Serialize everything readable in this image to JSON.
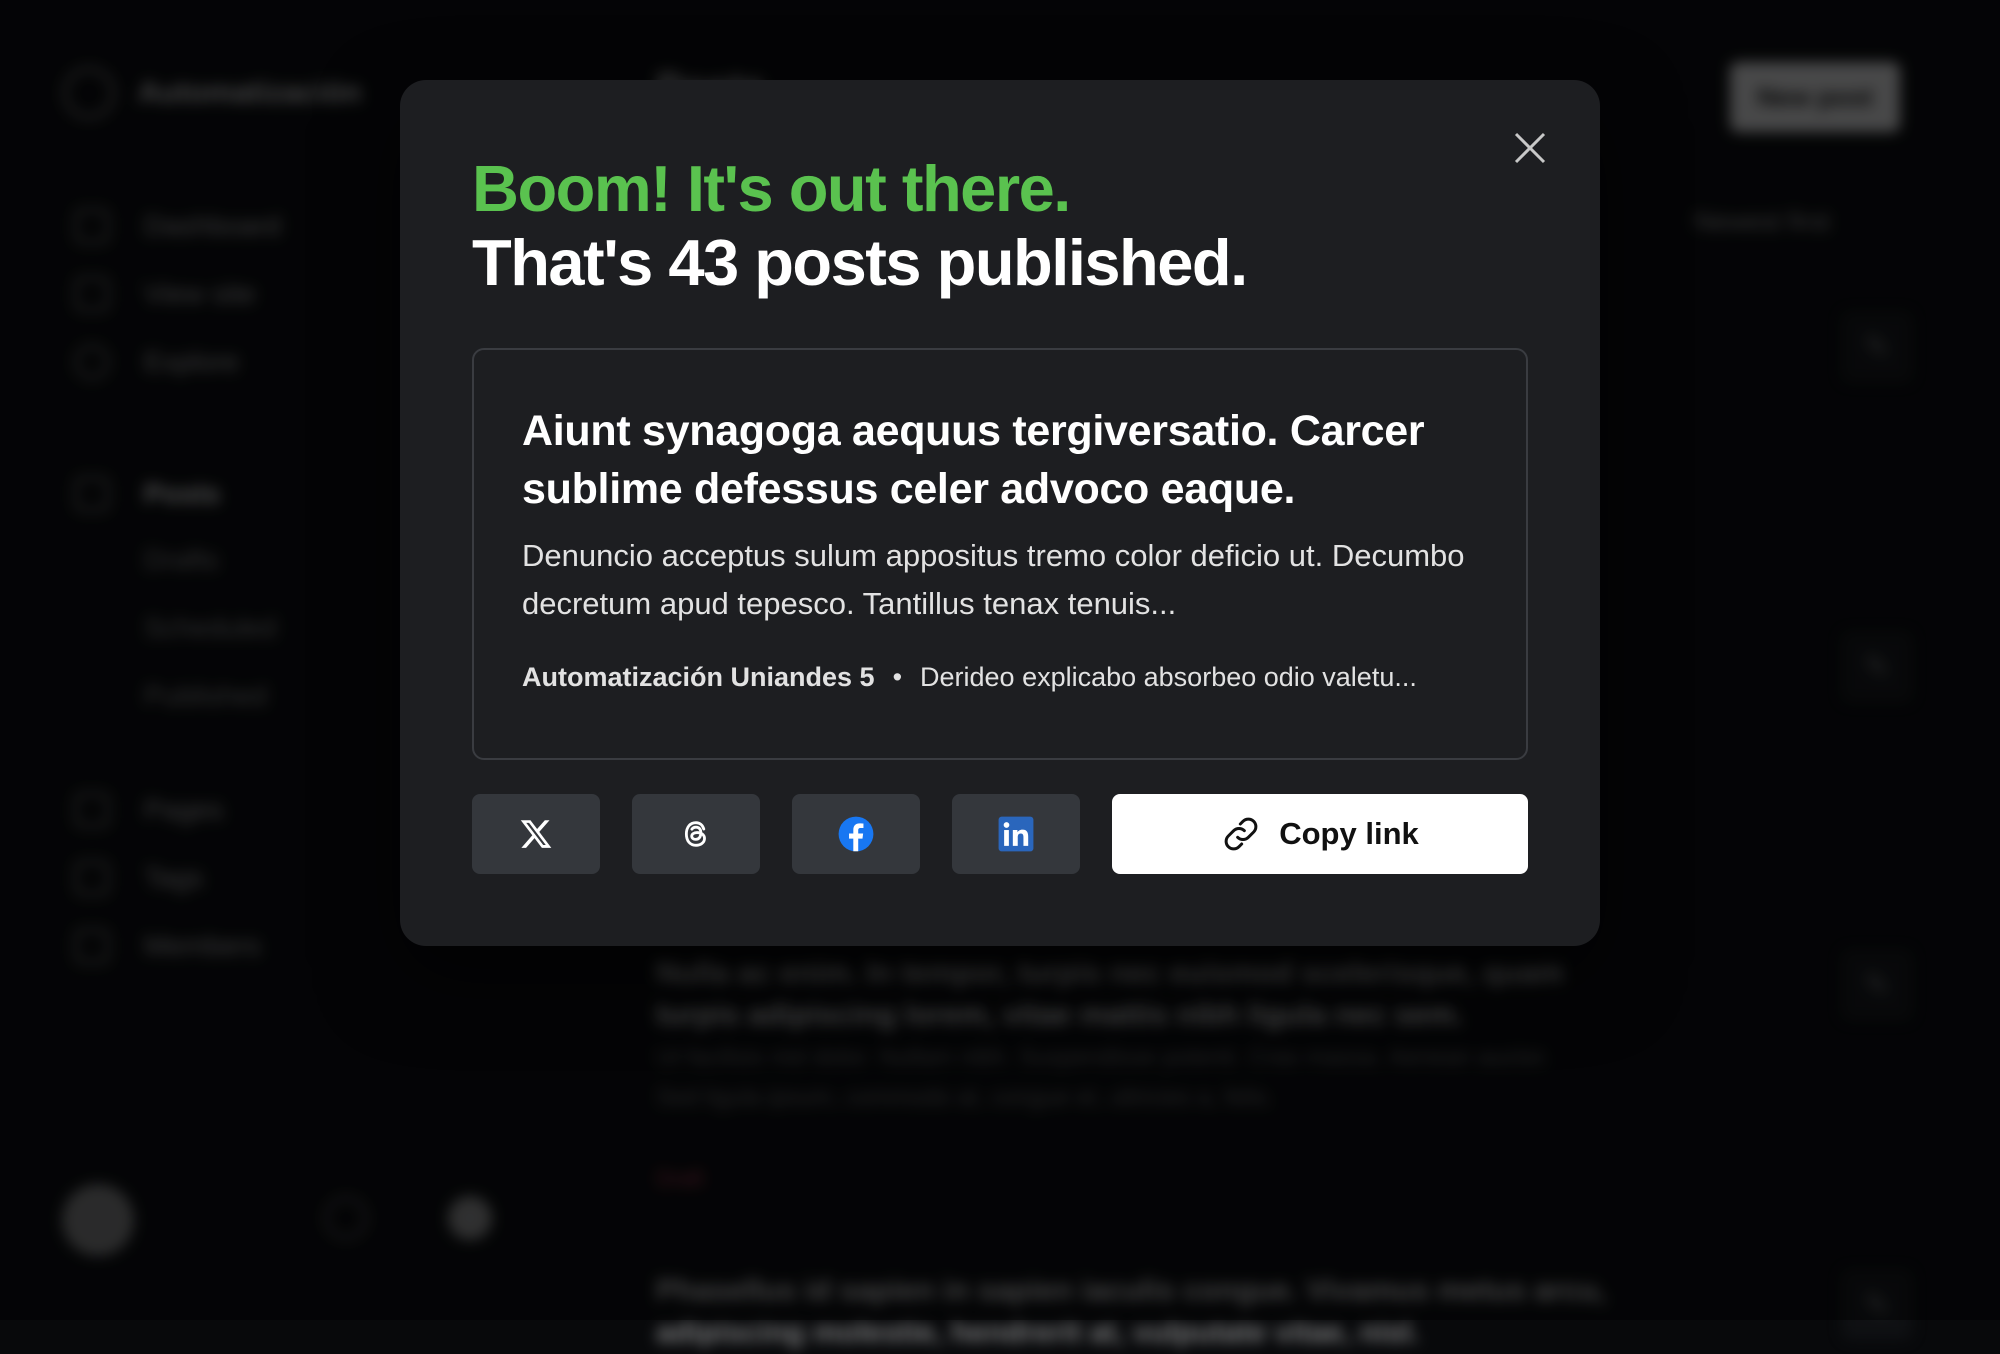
{
  "app": {
    "brand": "Automatización",
    "top_title": "Posts",
    "new_post_label": "New post",
    "sidebar": [
      {
        "label": "Dashboard"
      },
      {
        "label": "View site"
      },
      {
        "label": "Explore"
      },
      {
        "label": "Posts"
      },
      {
        "label": "Pages"
      },
      {
        "label": "Tags"
      },
      {
        "label": "Members"
      }
    ],
    "post_subnav": [
      "Drafts",
      "Scheduled",
      "Published"
    ],
    "filters": {
      "sort": "Newest first"
    },
    "posts": [
      {
        "title": "Nulla ac enim. In tempor, turpis nec euismod scelerisque, quam turpis adipiscing lorem, vitae mattis nibh ligula nec sem.",
        "excerpt": "Ut facilisis nisl dolor. Nullam nibh. Suspendisse potenti. Cras massa. Aenean auctor. Sed ligula ipsum, commodo at, congue et, ultricies a, felis.",
        "status": "Draft"
      },
      {
        "title": "Phasellus id sapien in sapien iaculis congue. Vivamus metus arcu, adipiscing molestie, hendrerit at, vulputate vitae, nisl."
      }
    ]
  },
  "modal": {
    "headline_accent": "Boom! It's out there.",
    "headline_main": "That's 43 posts published.",
    "preview": {
      "title": "Aiunt synagoga aequus tergiversatio. Carcer sublime defessus celer advoco eaque.",
      "excerpt": "Denuncio acceptus sulum appositus tremo color deficio ut. Decumbo decretum apud tepesco. Tantillus tenax tenuis...",
      "author": "Automatización Uniandes 5",
      "separator": "•",
      "meta_excerpt": "Derideo explicabo absorbeo odio valetu..."
    },
    "share": [
      {
        "name": "x-icon"
      },
      {
        "name": "threads-icon"
      },
      {
        "name": "facebook-icon"
      },
      {
        "name": "linkedin-icon"
      }
    ],
    "copy_link_label": "Copy link",
    "colors": {
      "accent": "#5ac24f",
      "facebook": "#1877f2",
      "linkedin": "#2a66bc"
    }
  }
}
